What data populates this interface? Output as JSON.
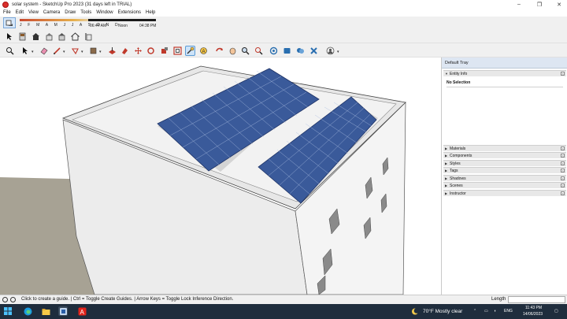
{
  "window": {
    "title": "solar system - SketchUp Pro 2023 (31 days left in TRIAL)",
    "controls": [
      "–",
      "❐",
      "✕"
    ]
  },
  "menu": [
    "File",
    "Edit",
    "View",
    "Camera",
    "Draw",
    "Tools",
    "Window",
    "Extensions",
    "Help"
  ],
  "shadow": {
    "months": "J F M A M J J A S O N D",
    "time_start": "06:44 AM",
    "time_mid": "Noon",
    "time_end": "04:38 PM"
  },
  "toolbar_row1": [
    "select-large-icon",
    "materials-icon",
    "home-view-icon",
    "front-view-icon",
    "right-view-icon",
    "back-view-icon",
    "left-view-icon",
    "house-outline-icon"
  ],
  "toolbar_row2": [
    "zoom-magnifier-icon",
    "select-arrow-icon",
    "eraser-icon",
    "line-pencil-icon",
    "shape-icon",
    "paint-bucket-icon",
    "push-pull-icon",
    "move-icon",
    "rotate-icon",
    "follow-me-icon",
    "scale-icon",
    "tape-measure-icon",
    "text-icon",
    "orbit-icon",
    "pan-icon",
    "zoom-icon",
    "zoom-extents-icon",
    "3d-warehouse-icon",
    "extension-warehouse-icon",
    "layout-icon",
    "extension-manager-icon",
    "user-account-icon"
  ],
  "tray": {
    "title": "Default Tray",
    "entity_info": "Entity Info",
    "selection": "No Selection",
    "panels": [
      "Materials",
      "Components",
      "Styles",
      "Tags",
      "Shadows",
      "Scenes",
      "Instructor"
    ]
  },
  "status": {
    "message": "Click to create a guide. | Ctrl = Toggle Create Guides. | Arrow Keys = Toggle Lock Inference Direction.",
    "length_label": "Length",
    "length_value": ""
  },
  "taskbar": {
    "weather": "70°F  Mostly clear",
    "lang": "ENG",
    "time": "11:43 PM",
    "date": "14/06/2023"
  },
  "colors": {
    "sky": "#ffffff",
    "ground": "#a7a294",
    "roof": "#e7e7e7",
    "panel": "#3a5a9a",
    "taskbar": "#1f2d3d"
  }
}
